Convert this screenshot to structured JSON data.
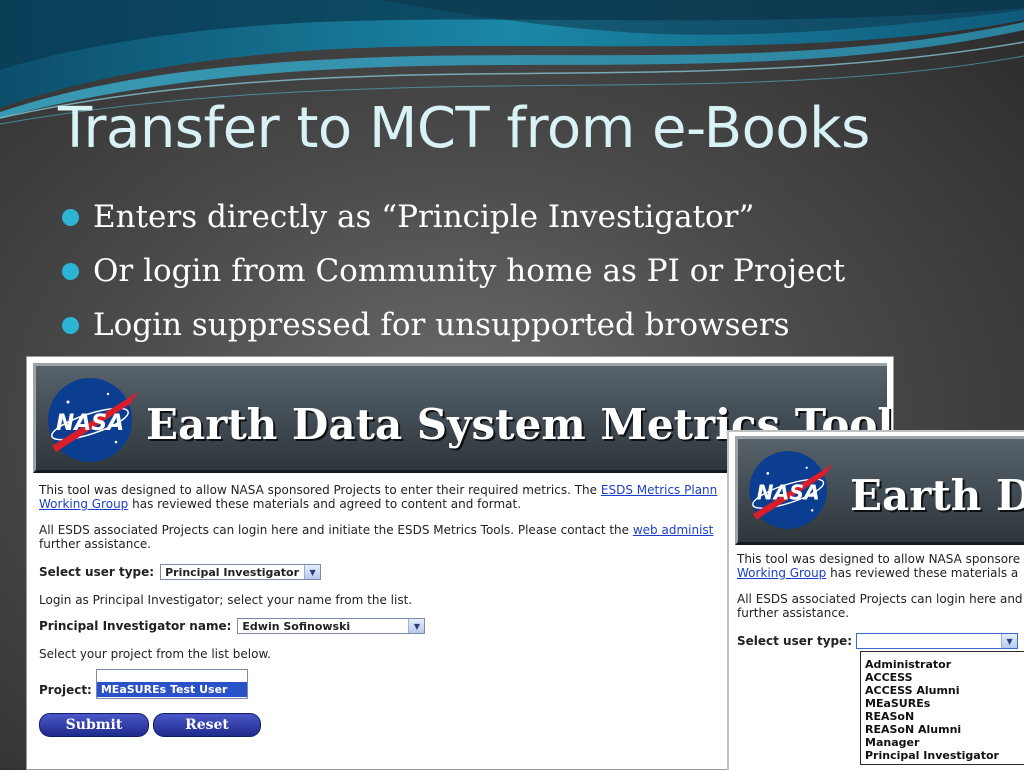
{
  "slide": {
    "title": "Transfer to MCT from e-Books",
    "bullets": [
      "Enters directly as “Principle Investigator”",
      "Or login from Community home as PI or Project",
      "Login suppressed for unsupported browsers"
    ]
  },
  "screenshot_main": {
    "banner_title": "Earth Data System Metrics Tool",
    "logo_text": "NASA",
    "intro_text_1": "This tool was designed to allow NASA sponsored Projects to enter their required metrics. The ",
    "intro_link_1": "ESDS Metrics Plann",
    "intro_link_2": "Working Group",
    "intro_text_2": " has reviewed these materials and agreed to content and format.",
    "login_text_1": "All ESDS associated Projects can login here and initiate the ESDS Metrics Tools. Please contact the ",
    "login_link": "web administ",
    "login_text_2": "further assistance.",
    "user_type_label": "Select user type:",
    "user_type_value": "Principal Investigator",
    "login_as_text": "Login as Principal Investigator; select your name from the list.",
    "pi_name_label": "Principal Investigator name:",
    "pi_name_value": "Edwin Sofinowski",
    "project_hint": "Select your project from the list below.",
    "project_label": "Project:",
    "project_selected": "MEaSUREs Test User",
    "submit_label": "Submit",
    "reset_label": "Reset"
  },
  "screenshot_overlay": {
    "banner_title": "Earth D",
    "logo_text": "NASA",
    "intro_text_1": "This tool was designed to allow NASA sponsore",
    "intro_link": "Working Group",
    "intro_text_2": " has reviewed these materials a",
    "login_text_1": "All ESDS associated Projects can login here and",
    "login_text_2": "further assistance.",
    "user_type_label": "Select user type:",
    "user_type_value": "",
    "options": [
      "Administrator",
      "ACCESS",
      "ACCESS Alumni",
      "MEaSUREs",
      "REASoN",
      "REASoN Alumni",
      "Manager",
      "Principal Investigator"
    ]
  },
  "colors": {
    "bullet": "#2cb4d4",
    "title": "#d8f2f6",
    "link": "#1a3ec8",
    "button": "#2a36a8"
  }
}
